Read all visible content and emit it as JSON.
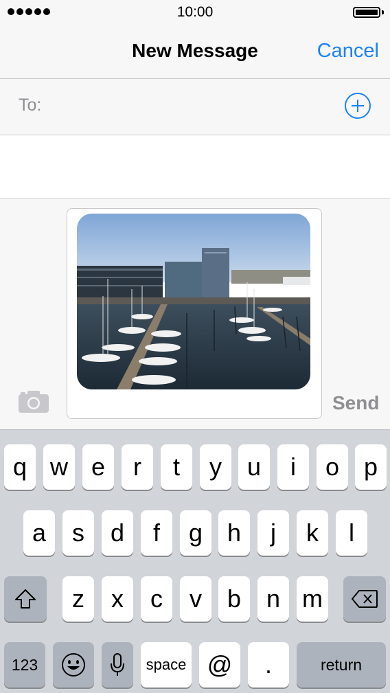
{
  "status_bar": {
    "time": "10:00"
  },
  "nav": {
    "title": "New Message",
    "cancel_label": "Cancel"
  },
  "to_field": {
    "label": "To:",
    "value": ""
  },
  "compose": {
    "send_label": "Send",
    "attachment": "photo-of-harbor-marina"
  },
  "keyboard": {
    "row1": [
      "q",
      "w",
      "e",
      "r",
      "t",
      "y",
      "u",
      "i",
      "o",
      "p"
    ],
    "row2": [
      "a",
      "s",
      "d",
      "f",
      "g",
      "h",
      "j",
      "k",
      "l"
    ],
    "row3": [
      "z",
      "x",
      "c",
      "v",
      "b",
      "n",
      "m"
    ],
    "bottom": {
      "numbers_label": "123",
      "emoji_icon": "emoji-icon",
      "mic_icon": "microphone-icon",
      "space_label": "space",
      "at_label": "@",
      "period_label": ".",
      "return_label": "return"
    },
    "shift_icon": "shift-icon",
    "delete_icon": "backspace-icon"
  },
  "colors": {
    "accent": "#1a82fb",
    "keyboard_bg": "#d1d4d9",
    "muted_text": "#8e8e93"
  }
}
